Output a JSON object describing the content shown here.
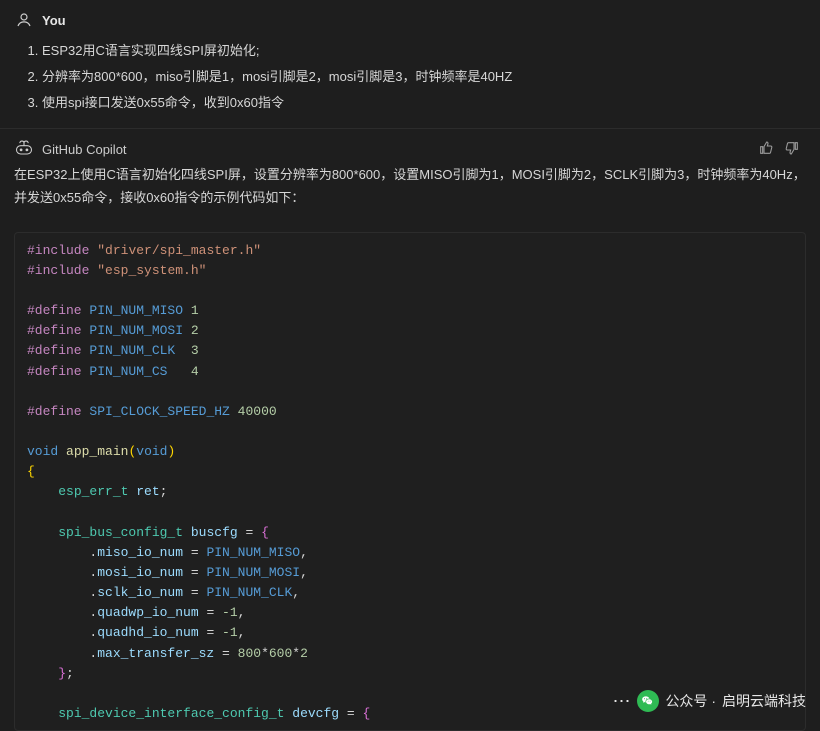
{
  "user": {
    "label": "You",
    "items": [
      "ESP32用C语言实现四线SPI屏初始化;",
      "分辨率为800*600，miso引脚是1，mosi引脚是2，mosi引脚是3，时钟频率是40HZ",
      "使用spi接口发送0x55命令，收到0x60指令"
    ]
  },
  "assistant": {
    "label": "GitHub Copilot",
    "body": "在ESP32上使用C语言初始化四线SPI屏，设置分辨率为800*600，设置MISO引脚为1，MOSI引脚为2，SCLK引脚为3，时钟频率为40Hz，并发送0x55命令，接收0x60指令的示例代码如下："
  },
  "code": {
    "inc1_kw": "#include",
    "inc1_str": "\"driver/spi_master.h\"",
    "inc2_kw": "#include",
    "inc2_str": "\"esp_system.h\"",
    "def_kw": "#define",
    "def_miso_name": "PIN_NUM_MISO",
    "def_miso_val": "1",
    "def_mosi_name": "PIN_NUM_MOSI",
    "def_mosi_val": "2",
    "def_clk_name": "PIN_NUM_CLK",
    "def_clk_val": "3",
    "def_cs_name": "PIN_NUM_CS",
    "def_cs_val": "4",
    "def_speed_name": "SPI_CLOCK_SPEED_HZ",
    "def_speed_val": "40000",
    "kw_void": "void",
    "fn_main": "app_main",
    "type_err": "esp_err_t",
    "var_ret": "ret",
    "type_buscfg": "spi_bus_config_t",
    "var_buscfg": "buscfg",
    "f_miso": "miso_io_num",
    "f_mosi": "mosi_io_num",
    "f_sclk": "sclk_io_num",
    "f_qwp": "quadwp_io_num",
    "f_qhd": "quadhd_io_num",
    "f_max": "max_transfer_sz",
    "neg1": "-1",
    "n800": "800",
    "n600": "600",
    "n2": "2",
    "type_devcfg": "spi_device_interface_config_t",
    "var_devcfg": "devcfg"
  },
  "watermark": {
    "prefix": "公众号 · ",
    "name": "启明云端科技"
  }
}
